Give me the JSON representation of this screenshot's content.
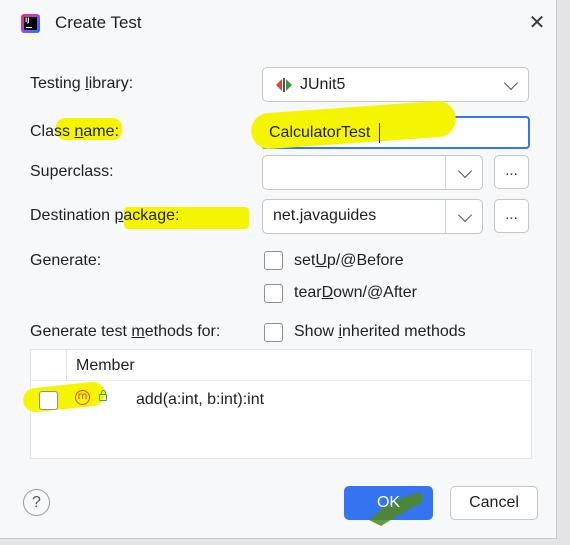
{
  "window": {
    "title": "Create Test"
  },
  "form": {
    "testing_library_label": "Testing library:",
    "testing_library_value": "JUnit5",
    "class_name_label": "Class name:",
    "class_name_value": "CalculatorTest",
    "superclass_label": "Superclass:",
    "superclass_value": "",
    "destination_package_label": "Destination package:",
    "destination_package_value": "net.javaguides",
    "generate_label": "Generate:",
    "setup_label": "setUp/@Before",
    "teardown_label": "tearDown/@After",
    "generate_methods_label": "Generate test methods for:",
    "show_inherited_label": "Show inherited methods",
    "browse_label": "..."
  },
  "table": {
    "column_member": "Member",
    "rows": [
      {
        "member": "add(a:int, b:int):int",
        "checked": false
      }
    ]
  },
  "buttons": {
    "ok": "OK",
    "cancel": "Cancel",
    "help": "?"
  },
  "icons": {
    "app": "intellij-idea-icon",
    "close": "close-icon",
    "junit": "junit-icon",
    "method": "method-icon",
    "visibility": "public-lock-icon"
  },
  "colors": {
    "accent": "#3574f0",
    "highlight": "#f5f500",
    "method_icon": "#e0433a"
  }
}
